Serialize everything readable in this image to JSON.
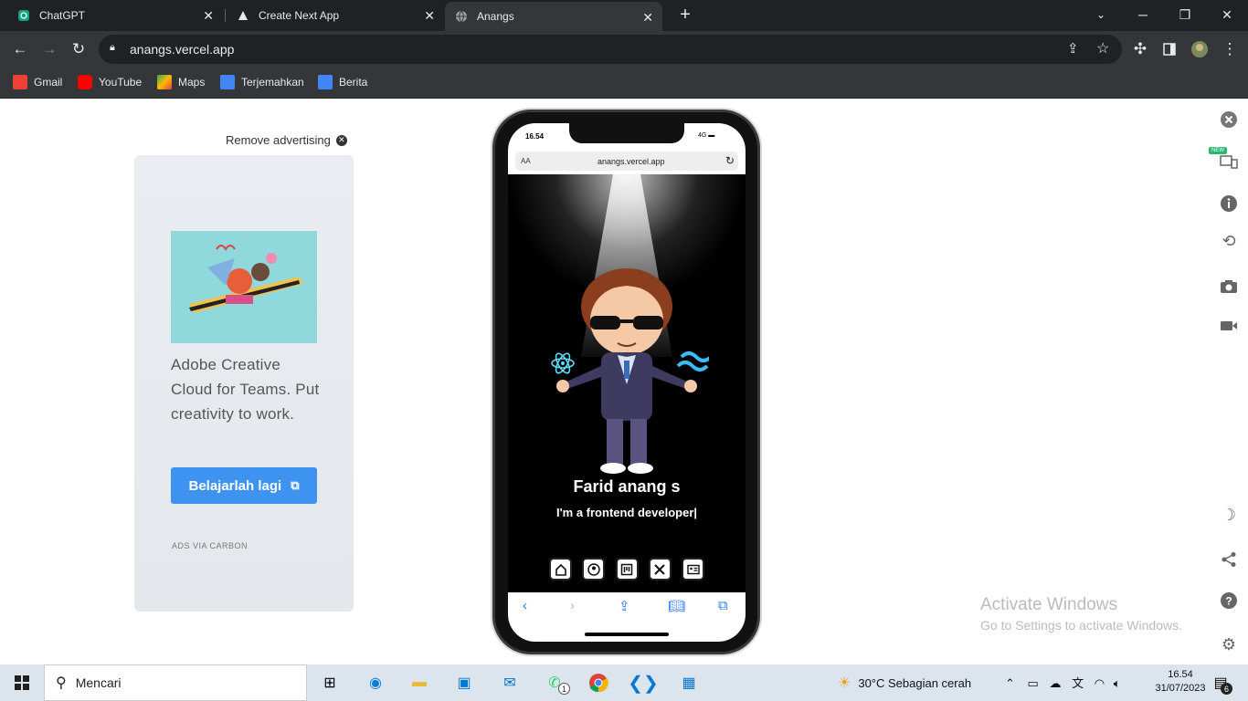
{
  "browser": {
    "tabs": [
      {
        "title": "ChatGPT",
        "icon": "chatgpt-icon"
      },
      {
        "title": "Create Next App",
        "icon": "triangle-icon"
      },
      {
        "title": "Anangs",
        "icon": "globe-icon",
        "active": true
      }
    ],
    "url": "anangs.vercel.app",
    "bookmarks": [
      {
        "label": "Gmail",
        "color": "#ea4335"
      },
      {
        "label": "YouTube",
        "color": "#ff0000"
      },
      {
        "label": "Maps",
        "color": "#34a853"
      },
      {
        "label": "Terjemahkan",
        "color": "#4285f4"
      },
      {
        "label": "Berita",
        "color": "#4285f4"
      }
    ]
  },
  "ad": {
    "remove_label": "Remove advertising",
    "copy": "Adobe Creative Cloud for Teams. Put creativity to work.",
    "button_label": "Belajarlah lagi",
    "via": "ADS VIA CARBON"
  },
  "phone": {
    "time": "16.54",
    "signal": "4G",
    "safari_aa": "AA",
    "url": "anangs.vercel.app",
    "name": "Farid anang s",
    "tagline": "I'm a frontend developer|",
    "nav_icons": [
      "home-icon",
      "user-icon",
      "projects-icon",
      "tools-icon",
      "contact-icon"
    ]
  },
  "sidebar_icons": [
    "close-icon",
    "responsive-icon",
    "info-icon",
    "rotate-icon",
    "camera-icon",
    "video-icon",
    "moon-icon",
    "share-icon",
    "help-icon",
    "settings-icon"
  ],
  "sidebar_badge": "NEW",
  "watermark": {
    "line1": "Activate Windows",
    "line2": "Go to Settings to activate Windows."
  },
  "taskbar": {
    "search_placeholder": "Mencari",
    "weather": "30°C  Sebagian cerah",
    "time": "16.54",
    "date": "31/07/2023",
    "whatsapp_badge": "1",
    "notification_count": "6"
  }
}
